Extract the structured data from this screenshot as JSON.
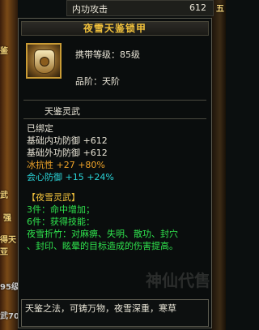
{
  "top_row": {
    "name": "内功攻击",
    "value": "612"
  },
  "right_edge_text": "五",
  "left_edges": [
    "鉴",
    "武",
    "强",
    "得天",
    "亚"
  ],
  "left_bottom": [
    "95级",
    "武70"
  ],
  "tooltip": {
    "title": "夜雪天鉴锁甲",
    "carry_level": "携带等级：85级",
    "grade": "品阶：天阶",
    "set_category": "天鉴灵武",
    "bound": "已绑定",
    "stats": [
      {
        "text": "基础内功防御 +612",
        "color": "white"
      },
      {
        "text": "基础外功防御 +612",
        "color": "white"
      },
      {
        "text": "冰抗性 +27 +80%",
        "color": "orange"
      },
      {
        "text": "会心防御 +15 +24%",
        "color": "cyan"
      }
    ],
    "set_name": "【夜雪灵武】",
    "set_bonus": [
      "3件：命中增加；",
      "6件：获得技能：",
      "夜雪折竹：对麻痹、失明、散功、封穴",
      "、封印、眩晕的目标造成的伤害提高。"
    ],
    "lore": "天鉴之法，可铸万物，夜雪深重，寒草"
  },
  "watermark": "神仙代售"
}
